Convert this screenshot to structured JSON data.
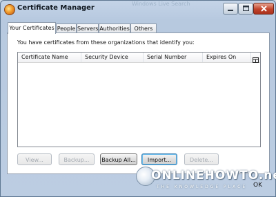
{
  "window": {
    "title": "Certificate Manager",
    "ghost_title": "Windows Live Search",
    "controls": {
      "minimize": "▭",
      "maximize": "▭",
      "close": "✕"
    }
  },
  "tabs": [
    {
      "label": "Your Certificates",
      "active": true
    },
    {
      "label": "People",
      "active": false
    },
    {
      "label": "Servers",
      "active": false
    },
    {
      "label": "Authorities",
      "active": false
    },
    {
      "label": "Others",
      "active": false
    }
  ],
  "panel": {
    "intro": "You have certificates from these organizations that identify you:",
    "columns": [
      "Certificate Name",
      "Security Device",
      "Serial Number",
      "Expires On"
    ],
    "rows": []
  },
  "buttons": [
    {
      "label": "View...",
      "enabled": false
    },
    {
      "label": "Backup...",
      "enabled": false
    },
    {
      "label": "Backup All...",
      "enabled": true
    },
    {
      "label": "Import...",
      "enabled": true
    },
    {
      "label": "Delete...",
      "enabled": false
    }
  ],
  "watermark": {
    "main": "ONLINEHOWTO.net",
    "sub": "THE KNOWLEDGE PLACE",
    "ok_fragment": "OK"
  },
  "colors": {
    "accent": "#3c7fb1",
    "close": "#c2442b"
  }
}
